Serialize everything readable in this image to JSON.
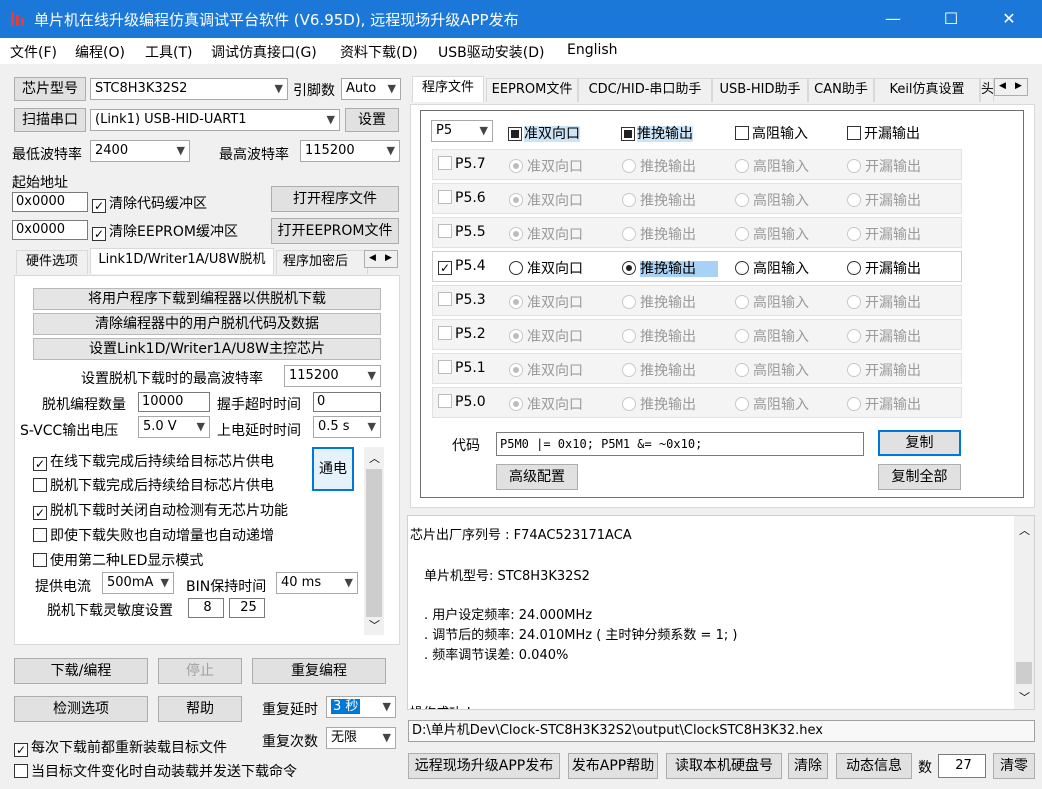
{
  "window": {
    "title": "单片机在线升级编程仿真调试平台软件 (V6.95D), 远程现场升级APP发布",
    "minimize": "—",
    "maximize": "☐",
    "close": "✕"
  },
  "menu": [
    "文件(F)",
    "编程(O)",
    "工具(T)",
    "调试仿真接口(G)",
    "资料下载(D)",
    "USB驱动安装(D)",
    "English"
  ],
  "left": {
    "chip_btn": "芯片型号",
    "chip_value": "STC8H3K32S2",
    "pin_label": "引脚数",
    "pin_value": "Auto",
    "scan_btn": "扫描串口",
    "port_value": "(Link1) USB-HID-UART1",
    "settings_btn": "设置",
    "min_baud_label": "最低波特率",
    "min_baud": "2400",
    "max_baud_label": "最高波特率",
    "max_baud": "115200",
    "start_addr_label": "起始地址",
    "addr1": "0x0000",
    "clear_code": "清除代码缓冲区",
    "open_prog_btn": "打开程序文件",
    "addr2": "0x0000",
    "clear_eeprom": "清除EEPROM缓冲区",
    "open_eeprom_btn": "打开EEPROM文件",
    "tabs": [
      "硬件选项",
      "Link1D/Writer1A/U8W脱机",
      "程序加密后"
    ],
    "btn_download_to_programmer": "将用户程序下载到编程器以供脱机下载",
    "btn_clear_programmer": "清除编程器中的用户脱机代码及数据",
    "btn_set_master": "设置Link1D/Writer1A/U8W主控芯片",
    "offline_max_baud_label": "设置脱机下载时的最高波特率",
    "offline_max_baud": "115200",
    "offline_count_label": "脱机编程数量",
    "offline_count": "10000",
    "handshake_label": "握手超时时间",
    "handshake": "0",
    "svcc_label": "S-VCC输出电压",
    "svcc": "5.0 V",
    "poweron_label": "上电延时时间",
    "poweron": "0.5 s",
    "opt1": "在线下载完成后持续给目标芯片供电",
    "opt2": "脱机下载完成后持续给目标芯片供电",
    "power_btn": "通电",
    "opt3": "脱机下载时关闭自动检测有无芯片功能",
    "opt4": "即使下载失败也自动增量也自动递增",
    "opt5": "使用第二种LED显示模式",
    "current_label": "提供电流",
    "current": "500mA",
    "bin_hold_label": "BIN保持时间",
    "bin_hold": "40 ms",
    "sensitivity_label": "脱机下载灵敏度设置",
    "sens1": "8",
    "sens2": "25",
    "download_btn": "下载/编程",
    "stop_btn": "停止",
    "repeat_btn": "重复编程",
    "detect_btn": "检测选项",
    "help_btn": "帮助",
    "repeat_delay_label": "重复延时",
    "repeat_delay": "3 秒",
    "reload_chk": "每次下载前都重新装载目标文件",
    "repeat_count_label": "重复次数",
    "repeat_count": "无限",
    "auto_send_chk": "当目标文件变化时自动装载并发送下载命令"
  },
  "right": {
    "tabs": [
      "程序文件",
      "EEPROM文件",
      "CDC/HID-串口助手",
      "USB-HID助手",
      "CAN助手",
      "Keil仿真设置",
      "头"
    ],
    "port_select": "P5",
    "header": {
      "opt1": "准双向口",
      "opt2": "推挽输出",
      "opt3": "高阻输入",
      "opt4": "开漏输出"
    },
    "rows": [
      {
        "pin": "P5.7",
        "on": false
      },
      {
        "pin": "P5.6",
        "on": false
      },
      {
        "pin": "P5.5",
        "on": false
      },
      {
        "pin": "P5.4",
        "on": true
      },
      {
        "pin": "P5.3",
        "on": false
      },
      {
        "pin": "P5.2",
        "on": false
      },
      {
        "pin": "P5.1",
        "on": false
      },
      {
        "pin": "P5.0",
        "on": false
      }
    ],
    "code_label": "代码",
    "code_value": "P5M0 |= 0x10; P5M1 &= ~0x10;",
    "copy_btn": "复制",
    "advanced_btn": "高级配置",
    "copy_all_btn": "复制全部",
    "log": [
      "芯片出厂序列号 : F74AC523171ACA",
      "单片机型号: STC8H3K32S2",
      ". 用户设定频率: 24.000MHz",
      ". 调节后的频率: 24.010MHz ( 主时钟分频系数 = 1; )",
      ". 频率调节误差: 0.040%",
      "操作成功 !"
    ],
    "path": "D:\\单片机Dev\\Clock-STC8H3K32S2\\output\\ClockSTC8H3K32.hex",
    "remote_btn": "远程现场升级APP发布",
    "app_help_btn": "发布APP帮助",
    "read_disk_btn": "读取本机硬盘号",
    "clear_btn": "清除",
    "dyn_info_btn": "动态信息",
    "count_label": "数",
    "count_value": "27",
    "reset_btn": "清零"
  }
}
